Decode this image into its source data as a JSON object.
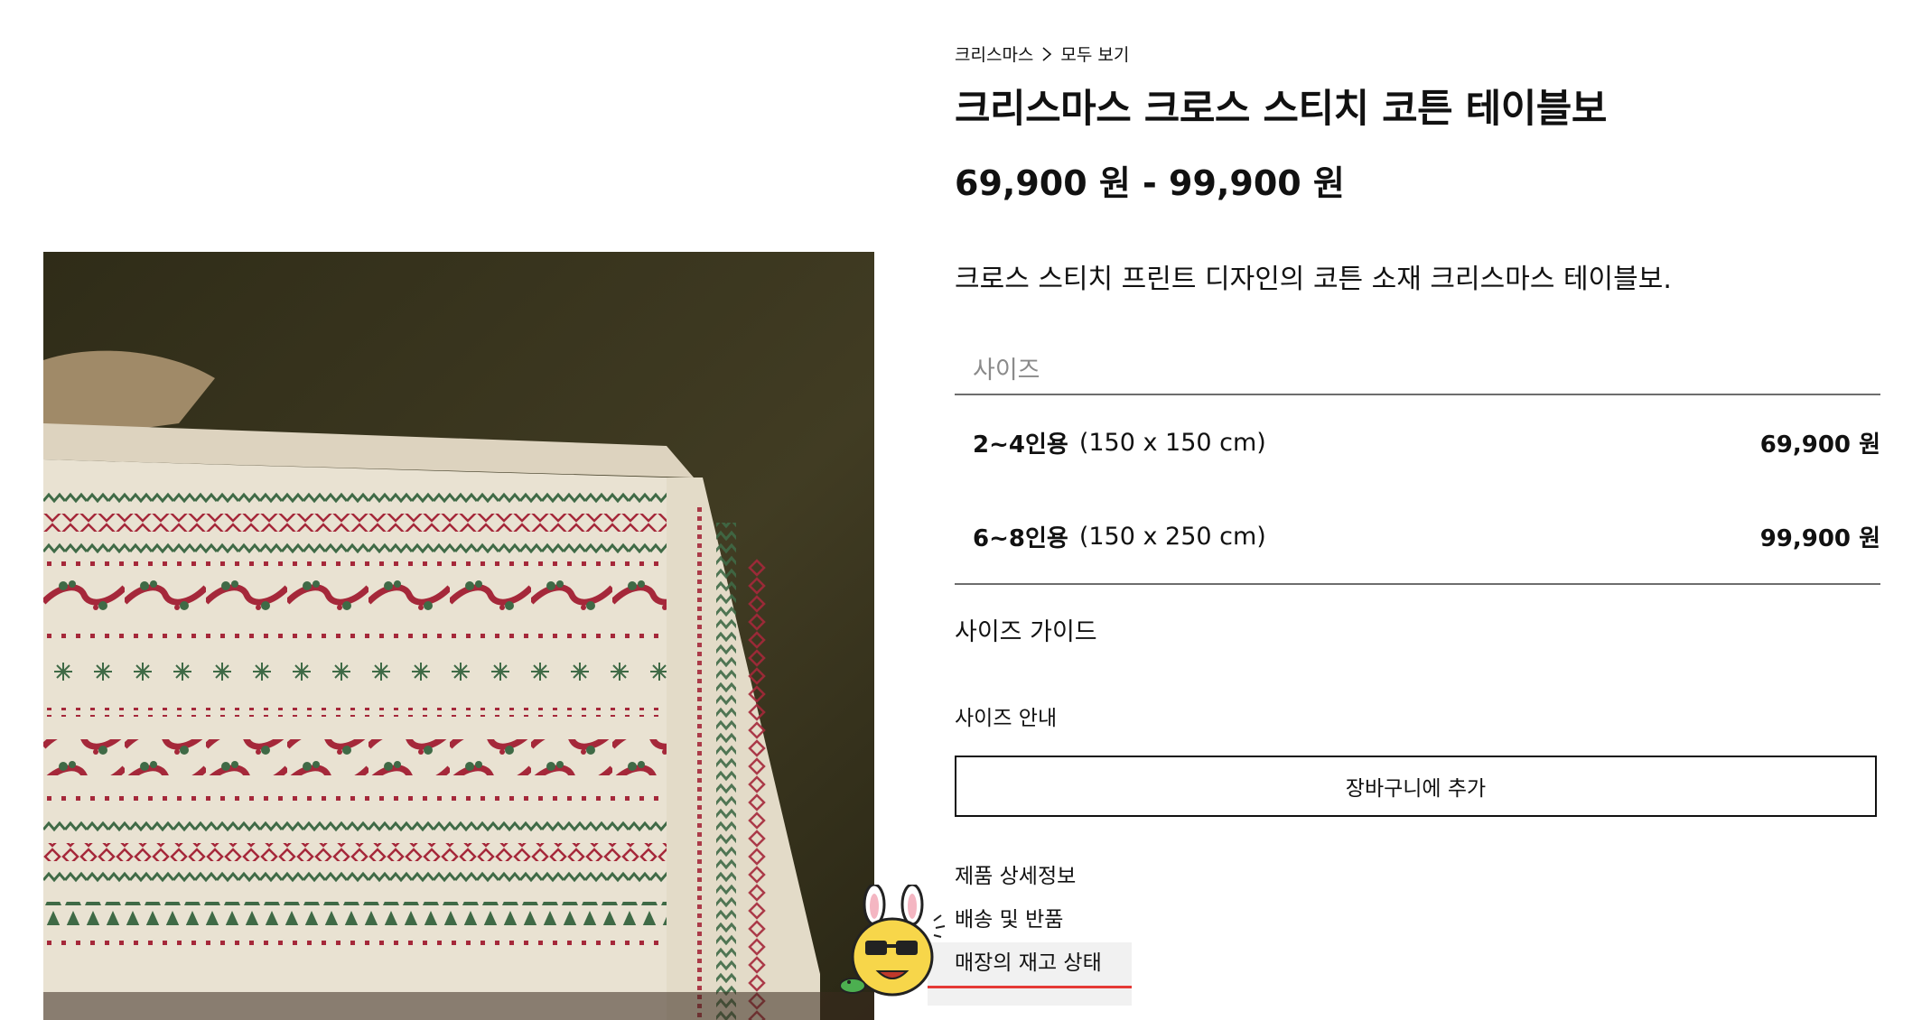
{
  "breadcrumb": {
    "category": "크리스마스",
    "current": "모두 보기"
  },
  "product": {
    "title": "크리스마스 크로스 스티치 코튼 테이블보",
    "price_range": "69,900 원 - 99,900 원",
    "description": "크로스 스티치 프린트 디자인의 코튼 소재 크리스마스 테이블보."
  },
  "sizes": {
    "header": "사이즈",
    "options": [
      {
        "name": "2~4인용",
        "dimensions": "(150 x 150 cm)",
        "price": "69,900 원"
      },
      {
        "name": "6~8인용",
        "dimensions": "(150 x 250 cm)",
        "price": "99,900 원"
      }
    ]
  },
  "links": {
    "size_guide": "사이즈 가이드",
    "size_info": "사이즈 안내",
    "add_to_cart": "장바구니에 추가",
    "product_details": "제품 상세정보",
    "shipping_returns": "배송 및 반품",
    "store_stock": "매장의 재고 상태"
  },
  "colors": {
    "background": "#ffffff",
    "text": "#111111",
    "muted": "#8a8a8a",
    "accent_underline": "#e53935",
    "image_backdrop": "#3a3620",
    "cloth": "#e9e2d2",
    "stitch_red": "#a5283a",
    "stitch_green": "#3f6a46"
  },
  "icons": {
    "breadcrumb_separator": "chevron-right-icon",
    "mascot": "rabbit-mascot-icon"
  }
}
